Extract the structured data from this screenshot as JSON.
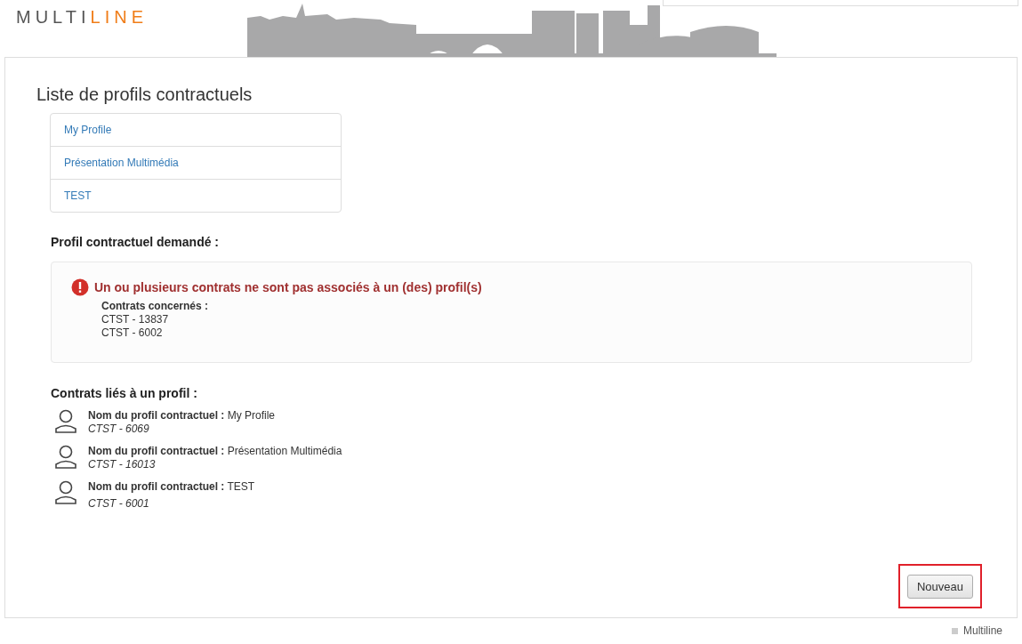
{
  "logo": {
    "main": "MULTI",
    "accent": "LINE"
  },
  "page_title": "Liste de profils contractuels",
  "profiles": [
    {
      "label": "My Profile"
    },
    {
      "label": "Présentation Multimédia"
    },
    {
      "label": "TEST"
    }
  ],
  "requested": {
    "heading": "Profil contractuel demandé :",
    "alert": {
      "message": "Un ou plusieurs contrats ne sont pas associés à un (des) profil(s)",
      "contracts_label": "Contrats concernés :",
      "contracts": [
        "CTST - 13837",
        "CTST - 6002"
      ]
    }
  },
  "linked": {
    "heading": "Contrats liés à un profil :",
    "items": [
      {
        "label": "Nom du profil contractuel :",
        "name": "My Profile",
        "contract": "CTST - 6069"
      },
      {
        "label": "Nom du profil contractuel :",
        "name": "Présentation Multimédia",
        "contract": "CTST - 16013"
      },
      {
        "label": "Nom du profil contractuel :",
        "name": "TEST",
        "contract": "CTST - 6001"
      }
    ]
  },
  "new_button": {
    "label": "Nouveau",
    "highlighted": true
  },
  "footer": "Multiline"
}
